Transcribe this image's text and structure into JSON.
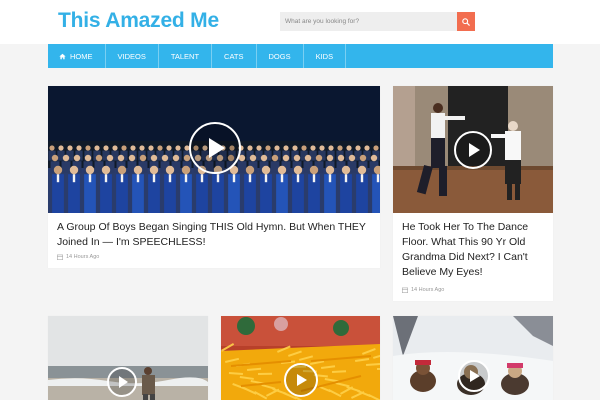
{
  "site": {
    "title": "This Amazed Me"
  },
  "search": {
    "placeholder": "What are you looking for?"
  },
  "nav": {
    "items": [
      {
        "label": "HOME"
      },
      {
        "label": "VIDEOS"
      },
      {
        "label": "TALENT"
      },
      {
        "label": "CATS"
      },
      {
        "label": "DOGS"
      },
      {
        "label": "KIDS"
      }
    ]
  },
  "articles": [
    {
      "title": "A Group Of Boys Began Singing THIS Old Hymn. But When THEY Joined In — I'm SPEECHLESS!",
      "time": "14 Hours Ago"
    },
    {
      "title": "He Took Her To The Dance Floor. What This 90 Yr Old Grandma Did Next? I Can't Believe My Eyes!",
      "time": "14 Hours Ago"
    },
    {
      "title": "",
      "time": ""
    },
    {
      "title": "",
      "time": ""
    },
    {
      "title": "",
      "time": ""
    }
  ],
  "colors": {
    "brand": "#33b0e6",
    "nav": "#33b5ec",
    "search_button": "#f26d4f"
  },
  "icons": {
    "search": "search-icon",
    "home": "home-icon",
    "clock": "clock-icon",
    "play": "play-icon"
  }
}
